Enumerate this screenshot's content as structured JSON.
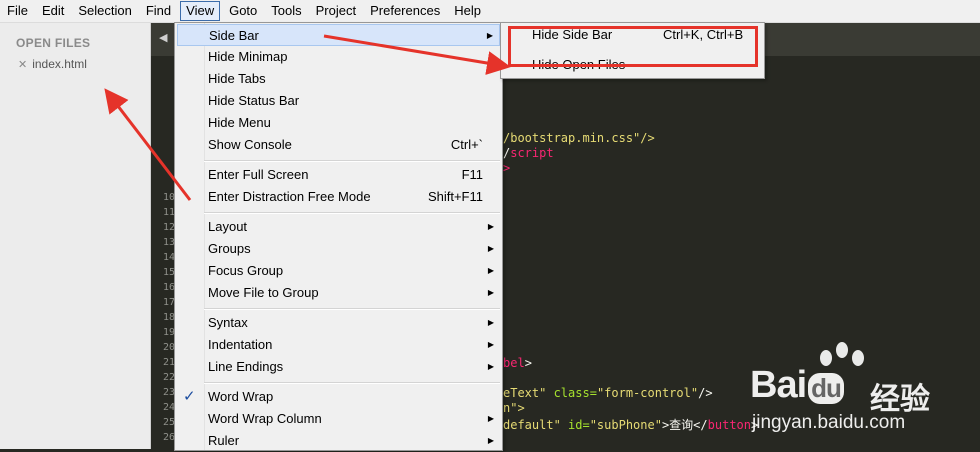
{
  "menubar": [
    "File",
    "Edit",
    "Selection",
    "Find",
    "View",
    "Goto",
    "Tools",
    "Project",
    "Preferences",
    "Help"
  ],
  "sidebar": {
    "title": "OPEN FILES",
    "file": "index.html"
  },
  "gutter_numbers": [
    "10",
    "11",
    "12",
    "13",
    "14",
    "15",
    "16",
    "17",
    "18",
    "19",
    "20",
    "21",
    "22",
    "23",
    "24",
    "25",
    "26"
  ],
  "code": {
    "line1": "/bootstrap.min.css\"/>",
    "line2a": "/",
    "line2b": "script",
    "line3": ">",
    "line4a": "bel",
    "line4b": ">",
    "line5a": "eText\"",
    "line5b": " class=",
    "line5c": "\"form-control\"",
    "line5d": "/>",
    "line6": "n\">",
    "line7a": "default\"",
    "line7b": " id=",
    "line7c": "\"subPhone\"",
    "line7d": ">查询</",
    "line7e": "button",
    "line7f": ">"
  },
  "view_menu": [
    {
      "label": "Side Bar",
      "submenu": true,
      "highlight": true
    },
    {
      "label": "Hide Minimap"
    },
    {
      "label": "Hide Tabs"
    },
    {
      "label": "Hide Status Bar"
    },
    {
      "label": "Hide Menu"
    },
    {
      "label": "Show Console",
      "shortcut": "Ctrl+`"
    },
    {
      "label": "Enter Full Screen",
      "shortcut": "F11"
    },
    {
      "label": "Enter Distraction Free Mode",
      "shortcut": "Shift+F11"
    },
    {
      "label": "Layout",
      "submenu": true
    },
    {
      "label": "Groups",
      "submenu": true
    },
    {
      "label": "Focus Group",
      "submenu": true
    },
    {
      "label": "Move File to Group",
      "submenu": true
    },
    {
      "label": "Syntax",
      "submenu": true
    },
    {
      "label": "Indentation",
      "submenu": true
    },
    {
      "label": "Line Endings",
      "submenu": true
    },
    {
      "label": "Word Wrap",
      "checked": true
    },
    {
      "label": "Word Wrap Column",
      "submenu": true
    },
    {
      "label": "Ruler",
      "submenu": true
    }
  ],
  "side_bar_menu": [
    {
      "label": "Hide Side Bar",
      "shortcut": "Ctrl+K, Ctrl+B"
    },
    {
      "label": "Hide Open Files"
    }
  ],
  "icons": {
    "check": "✓",
    "arrow": "▶",
    "close": "✕",
    "tab_left": "◀"
  },
  "annotation_color": "#e5332a",
  "watermark": {
    "brand": "Bai",
    "brand2": "du",
    "cn": "经验",
    "url": "jingyan.baidu.com"
  }
}
